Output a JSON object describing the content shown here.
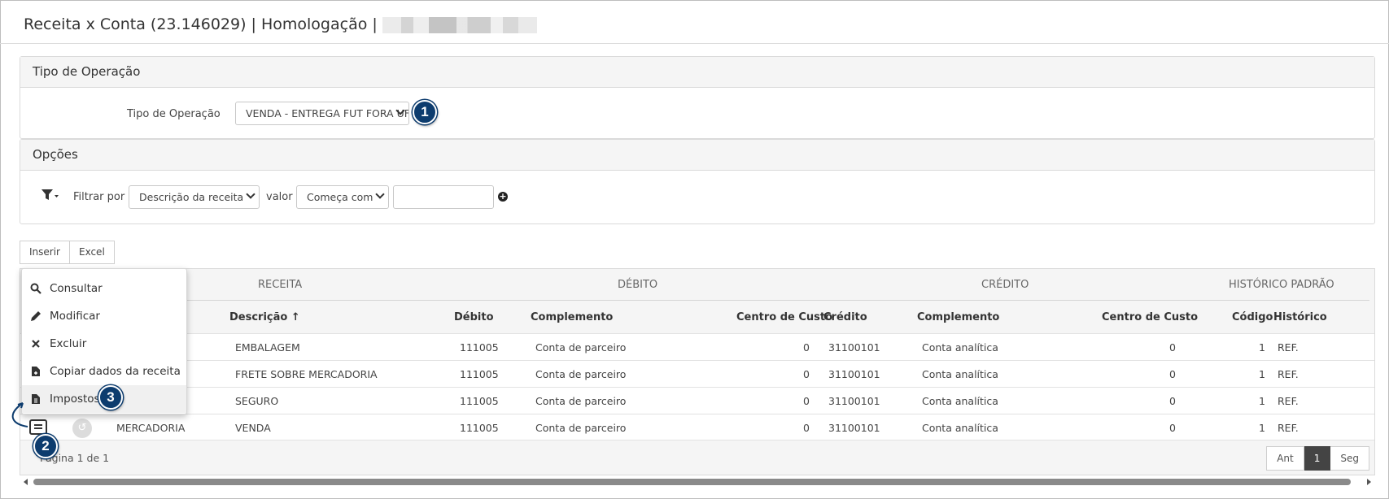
{
  "header": {
    "title": "Receita x Conta (23.146029) | Homologação |"
  },
  "tipo_operacao_panel": {
    "title": "Tipo de Operação",
    "label": "Tipo de Operação",
    "selected": "VENDA - ENTREGA FUT FORA UF"
  },
  "opcoes_panel": {
    "title": "Opções",
    "filtrar_label": "Filtrar por",
    "filtrar_selected": "Descrição da receita",
    "valor_label": "valor",
    "valor_selected": "Começa com",
    "search_value": ""
  },
  "toolbar": {
    "inserir_label": "Inserir",
    "excel_label": "Excel"
  },
  "table": {
    "groups": {
      "receita": "RECEITA",
      "debito": "DÉBITO",
      "credito": "CRÉDITO",
      "historico": "HISTÓRICO PADRÃO"
    },
    "columns": {
      "descricao": "Descrição ↑",
      "debito": "Débito",
      "complemento_d": "Complemento",
      "centro_d": "Centro de Custo",
      "credito": "Crédito",
      "complemento_c": "Complemento",
      "centro_c": "Centro de Custo",
      "codigo": "Código",
      "historico": "Histórico"
    },
    "rows": [
      {
        "tipo": "",
        "descricao": "EMBALAGEM",
        "debito": "111005",
        "complemento_d": "Conta de parceiro",
        "centro_d": "0",
        "credito": "31100101",
        "complemento_c": "Conta analítica",
        "centro_c": "0",
        "codigo": "1",
        "historico": "REF."
      },
      {
        "tipo": "",
        "descricao": "FRETE SOBRE MERCADORIA",
        "debito": "111005",
        "complemento_d": "Conta de parceiro",
        "centro_d": "0",
        "credito": "31100101",
        "complemento_c": "Conta analítica",
        "centro_c": "0",
        "codigo": "1",
        "historico": "REF."
      },
      {
        "tipo": "",
        "descricao": "SEGURO",
        "debito": "111005",
        "complemento_d": "Conta de parceiro",
        "centro_d": "0",
        "credito": "31100101",
        "complemento_c": "Conta analítica",
        "centro_c": "0",
        "codigo": "1",
        "historico": "REF."
      },
      {
        "tipo": "MERCADORIA",
        "descricao": "VENDA",
        "debito": "111005",
        "complemento_d": "Conta de parceiro",
        "centro_d": "0",
        "credito": "31100101",
        "complemento_c": "Conta analítica",
        "centro_c": "0",
        "codigo": "1",
        "historico": "REF."
      }
    ],
    "pager_text": "Página 1 de 1",
    "pager": {
      "prev": "Ant",
      "current": "1",
      "next": "Seg"
    }
  },
  "context_menu": {
    "items": [
      {
        "label": "Consultar",
        "icon": "search-icon"
      },
      {
        "label": "Modificar",
        "icon": "pencil-icon"
      },
      {
        "label": "Excluir",
        "icon": "close-icon"
      },
      {
        "label": "Copiar dados da receita",
        "icon": "file-copy-icon"
      },
      {
        "label": "Impostos",
        "icon": "file-text-icon"
      }
    ]
  },
  "callouts": {
    "one": "1",
    "two": "2",
    "three": "3"
  },
  "colors": {
    "badge": "#0d3c6e",
    "header_bg": "#f5f5f5",
    "active_page": "#444444"
  }
}
